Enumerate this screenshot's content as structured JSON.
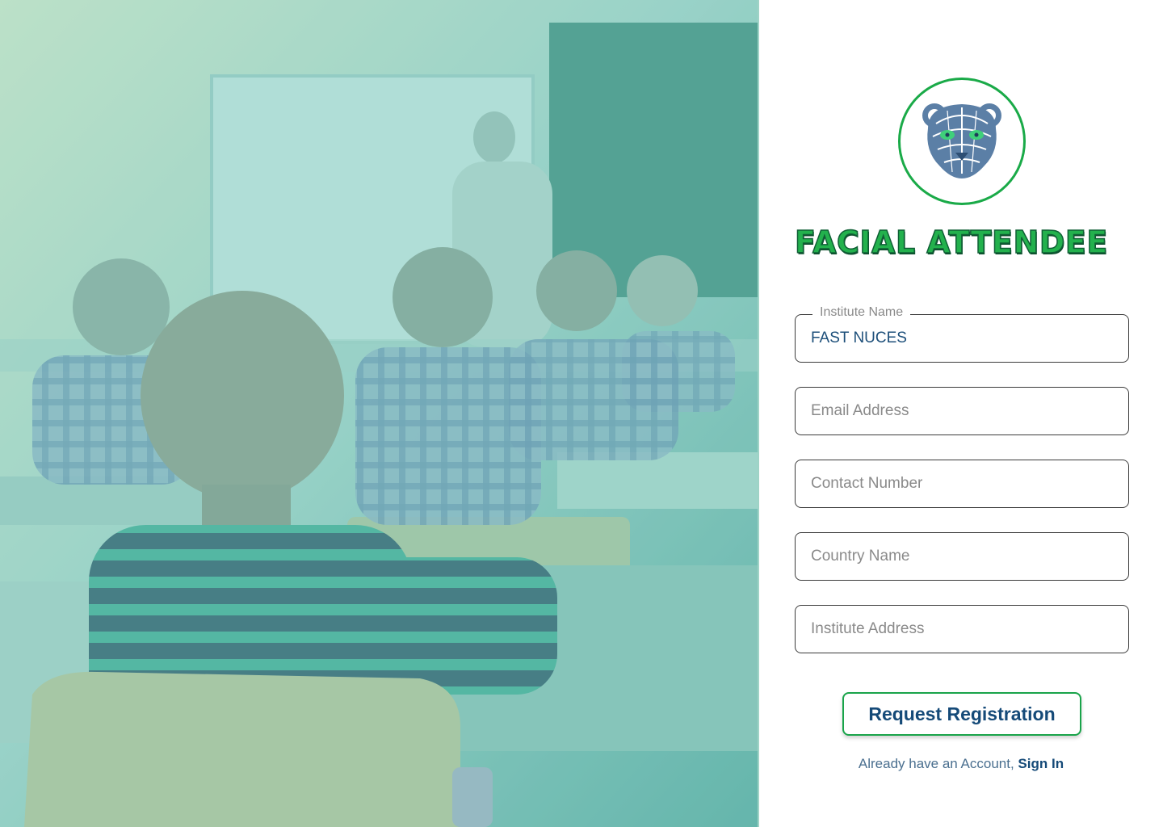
{
  "brand": {
    "name": "FACIAL ATTENDEE",
    "logo_icon": "tiger-head-icon",
    "colors": {
      "brand_green": "#23b14d",
      "ring_green": "#1aaa48",
      "navy": "#154a78"
    }
  },
  "hero": {
    "image_subject": "classroom-photo"
  },
  "form": {
    "institute_name": {
      "label": "Institute Name",
      "value": "FAST NUCES"
    },
    "email": {
      "placeholder": "Email Address"
    },
    "contact": {
      "placeholder": "Contact Number"
    },
    "country": {
      "placeholder": "Country Name"
    },
    "address": {
      "placeholder": "Institute Address"
    },
    "submit_label": "Request Registration"
  },
  "footer": {
    "prompt": "Already have an Account,",
    "signin_label": "Sign In"
  }
}
